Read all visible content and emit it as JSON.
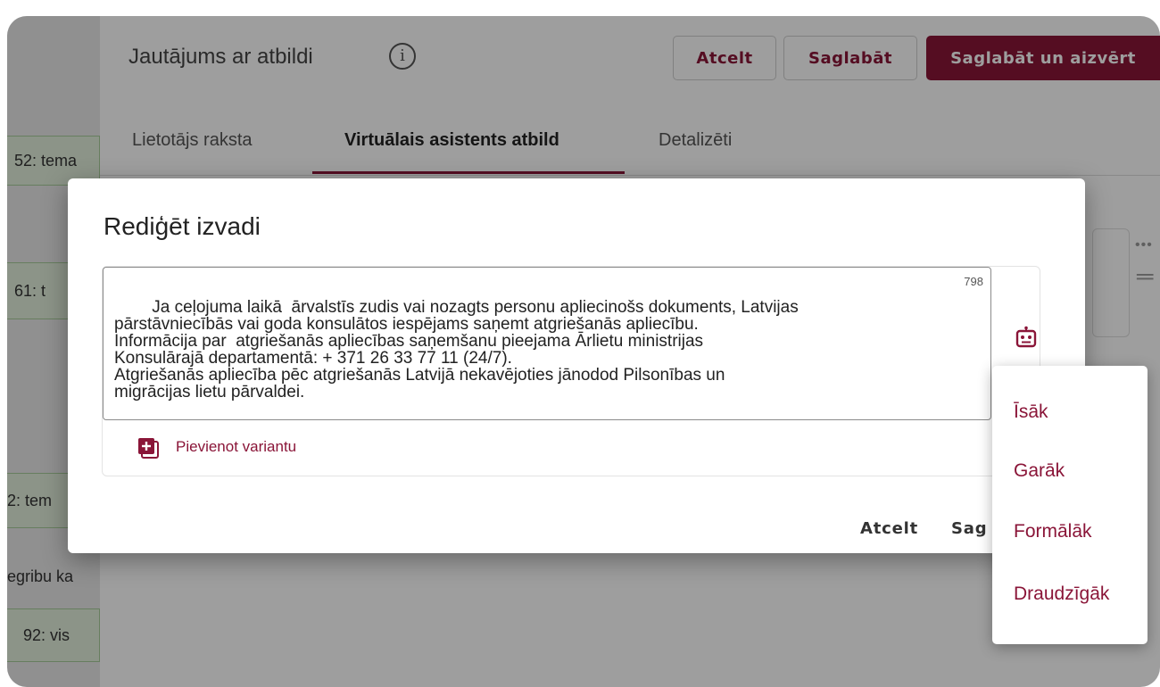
{
  "canvas": {
    "nodes": [
      "52: tema",
      "61: t",
      "2: tem",
      "egribu ka",
      "92: vis"
    ]
  },
  "panel": {
    "title": "Jautājums ar atbildi",
    "info_icon": "i",
    "buttons": {
      "cancel": "Atcelt",
      "save": "Saglabāt",
      "save_close": "Saglabāt un aizvērt"
    },
    "tabs": [
      "Lietotājs raksta",
      "Virtuālais asistents atbild",
      "Detalizēti"
    ],
    "active_tab_index": 1
  },
  "dialog": {
    "title": "Rediģēt izvadi",
    "text": "Ja ceļojuma laikā  ārvalstīs zudis vai nozagts personu apliecinošs dokuments, Latvijas\npārstāvniecībās vai goda konsulātos iespējams saņemt atgriešanās apliecību.\nInformācija par  atgriešanās apliecības saņemšanu pieejama Ārlietu ministrijas\nKonsulārajā departamentā: + 371 26 33 77 11 (24/7).\nAtgriešanās apliecība pēc atgriešanās Latvijā nekavējoties jānodod Pilsonības un\nmigrācijas lietu pārvaldei.",
    "char_count": "798",
    "add_variant_label": "Pievienot variantu",
    "footer": {
      "cancel": "Atcelt",
      "save": "Saglabāt"
    }
  },
  "menu": {
    "items": [
      "Īsāk",
      "Garāk",
      "Formālāk",
      "Draudzīgāk"
    ]
  },
  "colors": {
    "accent": "#8a1538",
    "node_fill": "#e2efdc",
    "node_border": "#a6cb99"
  },
  "icons": {
    "info": "info-icon",
    "robot": "robot-icon",
    "add": "add-box-icon"
  }
}
